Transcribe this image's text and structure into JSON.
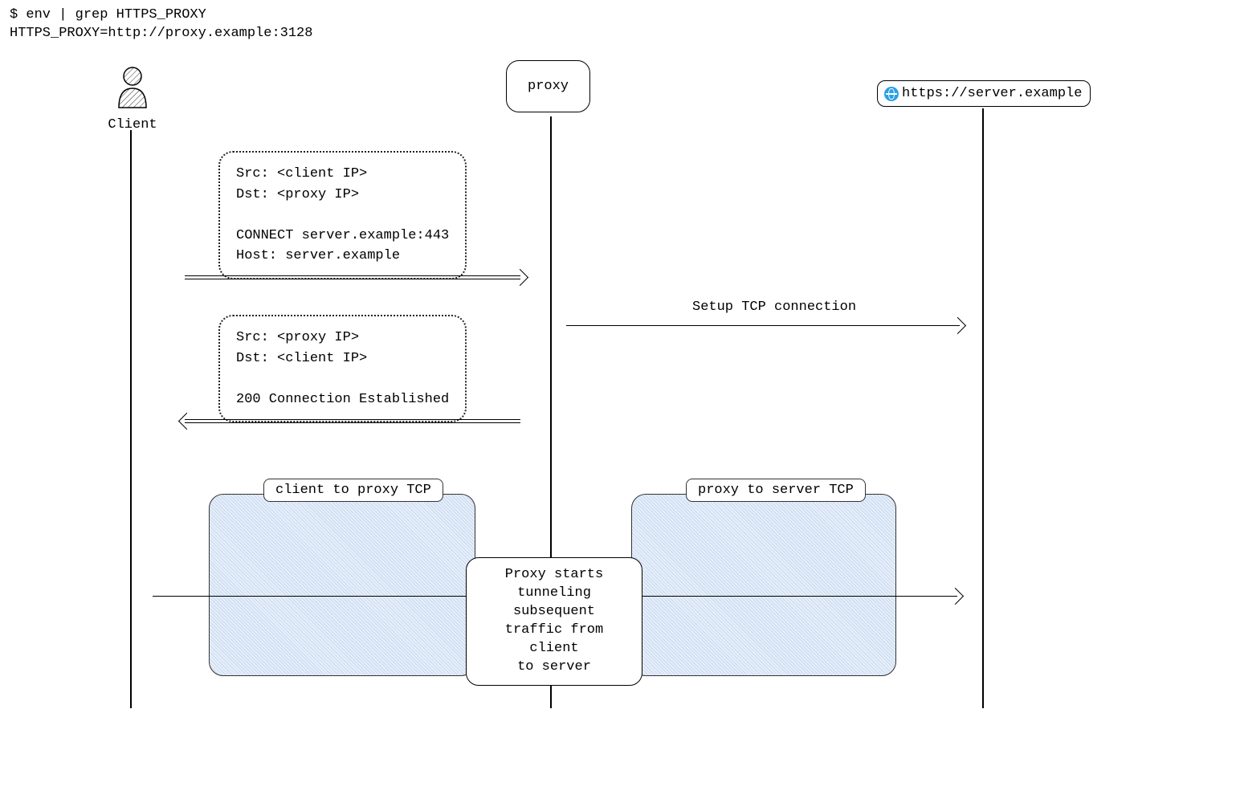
{
  "terminal": {
    "command": "$ env | grep HTTPS_PROXY",
    "output": "HTTPS_PROXY=http://proxy.example:3128"
  },
  "actors": {
    "client": {
      "label": "Client"
    },
    "proxy": {
      "label": "proxy"
    },
    "server": {
      "url": "https://server.example"
    }
  },
  "messages": {
    "connect_request": {
      "text": "Src: <client IP>\nDst: <proxy IP>\n\nCONNECT server.example:443\nHost: server.example"
    },
    "setup_tcp": {
      "label": "Setup TCP connection"
    },
    "connect_response": {
      "text": "Src: <proxy IP>\nDst: <client IP>\n\n200 Connection Established"
    }
  },
  "tcp_boxes": {
    "client_proxy": {
      "label": "client to proxy TCP"
    },
    "proxy_server": {
      "label": "proxy to server TCP"
    }
  },
  "tunnel_note": {
    "text": "Proxy starts\ntunneling subsequent\ntraffic from client\nto server"
  }
}
